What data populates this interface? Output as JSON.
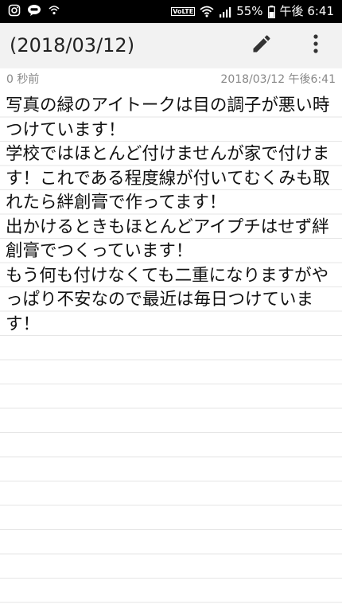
{
  "status_bar": {
    "left_icons": [
      "instagram-icon",
      "line-icon",
      "wifi-calling-icon"
    ],
    "volte": "VoLTE",
    "battery_percent": "55%",
    "time": "午後 6:41"
  },
  "header": {
    "title": "(2018/03/12)",
    "edit_icon": "pencil-icon",
    "more_icon": "more-vert-icon"
  },
  "meta": {
    "relative_time": "0 秒前",
    "timestamp": "2018/03/12 午後6:41"
  },
  "note": {
    "body": "写真の緑のアイトークは目の調子が悪い時つけています！\n学校ではほとんど付けませんが家で付けます！これである程度線が付いてむくみも取れたら絆創膏で作ってます！\n出かけるときもほとんどアイプチはせず絆創膏でつくっています！\nもう何も付けなくても二重になりますがやっぱり不安なので最近は毎日つけています！"
  }
}
